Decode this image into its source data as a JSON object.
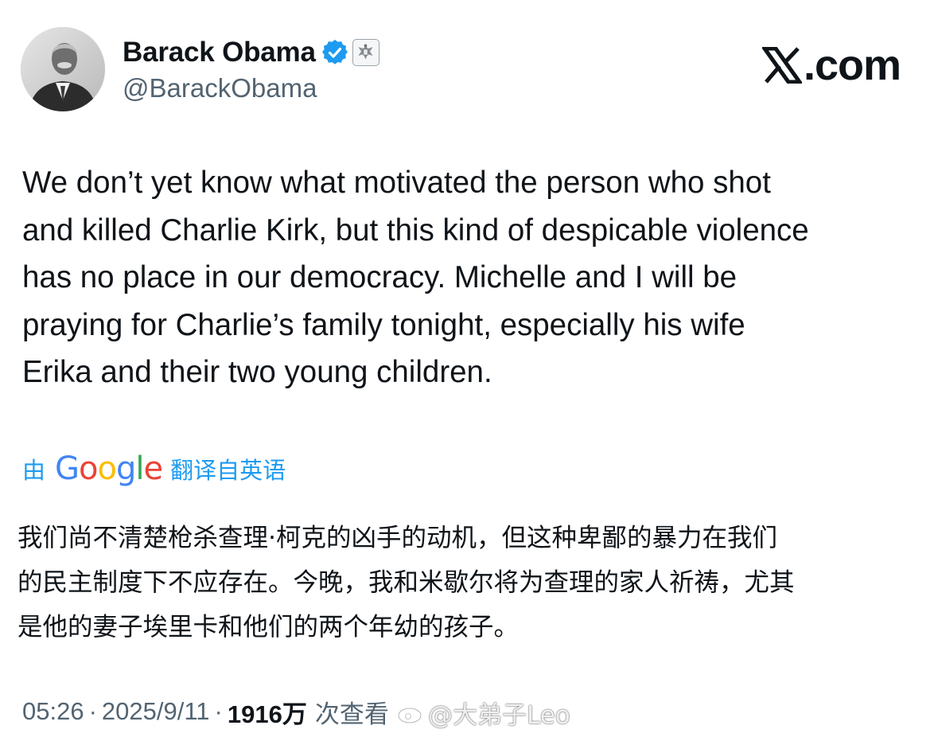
{
  "author": {
    "display_name": "Barack Obama",
    "handle": "@BarackObama",
    "avatar_icon": "profile-photo",
    "verified_icon": "verified-badge-icon",
    "affiliation_icon": "government-seal-icon",
    "verified_color": "#1d9bf0"
  },
  "brand": {
    "logo_text": ".com",
    "logo_icon": "x-logo-icon"
  },
  "tweet": {
    "text": "We don’t yet know what motivated the person who shot\nand killed Charlie Kirk, but this kind of despicable violence\nhas no place in our democracy. Michelle and I will be\npraying for Charlie’s family tonight, especially his wife\nErika and their two young children."
  },
  "translation": {
    "prefix": "由",
    "provider": "Google",
    "suffix": "翻译自英语",
    "link_color": "#1d9bf0",
    "text": "我们尚不清楚枪杀查理·柯克的凶手的动机，但这种卑鄙的暴力在我们\n的民主制度下不应存在。今晚，我和米歇尔将为查理的家人祈祷，尤其\n是他的妻子埃里卡和他们的两个年幼的孩子。"
  },
  "meta": {
    "time": "05:26",
    "separator": "·",
    "date": "2025/9/11",
    "views_count": "1916万",
    "views_label": "次查看"
  },
  "watermark": {
    "text": "@大弟子Leo",
    "icon": "weibo-icon"
  }
}
